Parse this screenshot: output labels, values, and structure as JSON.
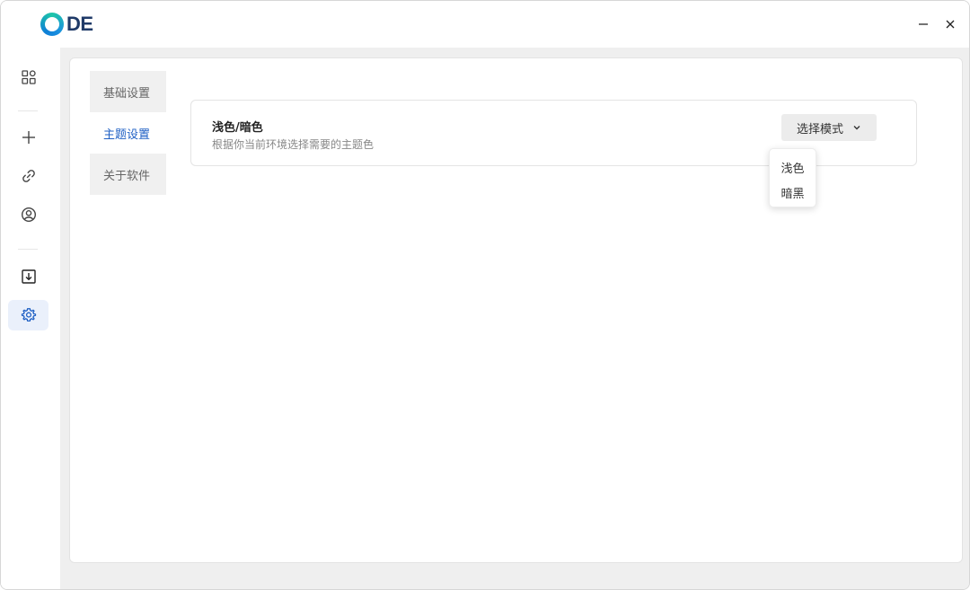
{
  "app": {
    "logo_text": "DE"
  },
  "window_controls": {
    "minimize": "minimize-icon",
    "close": "close-icon"
  },
  "rail": {
    "items": [
      {
        "name": "apps",
        "icon": "grid-icon",
        "active": false
      },
      {
        "name": "add",
        "icon": "plus-icon",
        "active": false
      },
      {
        "name": "link",
        "icon": "link-icon",
        "active": false
      },
      {
        "name": "account",
        "icon": "user-circle-icon",
        "active": false
      },
      {
        "name": "download",
        "icon": "download-icon",
        "active": false
      },
      {
        "name": "settings",
        "icon": "gear-icon",
        "active": true
      }
    ]
  },
  "tabs": [
    {
      "label": "基础设置",
      "active": false
    },
    {
      "label": "主题设置",
      "active": true
    },
    {
      "label": "关于软件",
      "active": false
    }
  ],
  "theme_setting": {
    "title": "浅色/暗色",
    "description": "根据你当前环境选择需要的主题色",
    "select_label": "选择模式",
    "options": [
      "浅色",
      "暗黑"
    ]
  },
  "colors": {
    "accent": "#1e5fc4",
    "active_bg": "#eaf0fb"
  }
}
